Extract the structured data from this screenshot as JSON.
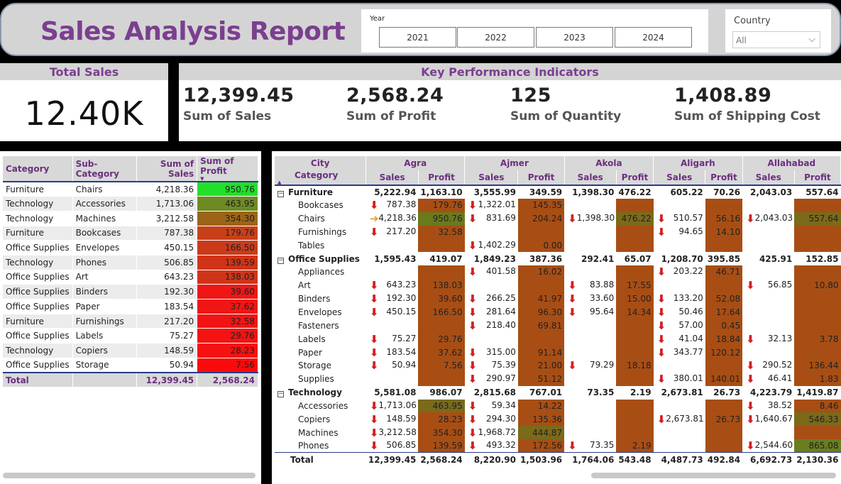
{
  "header": {
    "title": "Sales Analysis Report",
    "year_label": "Year",
    "years": [
      "2021",
      "2022",
      "2023",
      "2024"
    ],
    "country_label": "Country",
    "country_value": "All"
  },
  "total_card": {
    "title": "Total Sales",
    "value": "12.40K"
  },
  "kpi": {
    "title": "Key Performance Indicators",
    "items": [
      {
        "value": "12,399.45",
        "label": "Sum of Sales"
      },
      {
        "value": "2,568.24",
        "label": "Sum of Profit"
      },
      {
        "value": "125",
        "label": "Sum of Quantity"
      },
      {
        "value": "1,408.89",
        "label": "Sum of Shipping Cost"
      }
    ]
  },
  "left_table": {
    "headers": [
      "Category",
      "Sub-Category",
      "Sum of Sales",
      "Sum of Profit"
    ],
    "rows": [
      {
        "c": "Furniture",
        "s": "Chairs",
        "sales": "4,218.36",
        "profit": "950.76",
        "color": "#22e02a"
      },
      {
        "c": "Technology",
        "s": "Accessories",
        "sales": "1,713.06",
        "profit": "463.95",
        "color": "#6f8a22"
      },
      {
        "c": "Technology",
        "s": "Machines",
        "sales": "3,212.58",
        "profit": "354.30",
        "color": "#9c6418"
      },
      {
        "c": "Furniture",
        "s": "Bookcases",
        "sales": "787.38",
        "profit": "179.76",
        "color": "#c8401a"
      },
      {
        "c": "Office Supplies",
        "s": "Envelopes",
        "sales": "450.15",
        "profit": "166.50",
        "color": "#cc3a1a"
      },
      {
        "c": "Technology",
        "s": "Phones",
        "sales": "506.85",
        "profit": "139.59",
        "color": "#d03418"
      },
      {
        "c": "Office Supplies",
        "s": "Art",
        "sales": "643.23",
        "profit": "138.03",
        "color": "#d03418"
      },
      {
        "c": "Office Supplies",
        "s": "Binders",
        "sales": "192.30",
        "profit": "39.60",
        "color": "#f01616"
      },
      {
        "c": "Office Supplies",
        "s": "Paper",
        "sales": "183.54",
        "profit": "37.62",
        "color": "#f01616"
      },
      {
        "c": "Furniture",
        "s": "Furnishings",
        "sales": "217.20",
        "profit": "32.58",
        "color": "#f21414"
      },
      {
        "c": "Office Supplies",
        "s": "Labels",
        "sales": "75.27",
        "profit": "29.76",
        "color": "#f41212"
      },
      {
        "c": "Technology",
        "s": "Copiers",
        "sales": "148.59",
        "profit": "28.23",
        "color": "#f41212"
      },
      {
        "c": "Office Supplies",
        "s": "Storage",
        "sales": "50.94",
        "profit": "7.56",
        "color": "#fa0a0a"
      }
    ],
    "total": {
      "label": "Total",
      "sales": "12,399.45",
      "profit": "2,568.24"
    }
  },
  "matrix": {
    "row_header_top": "City",
    "row_header_bottom": "Category",
    "cities": [
      "Agra",
      "Ajmer",
      "Akola",
      "Aligarh",
      "Allahabad"
    ],
    "measure_labels": [
      "Sales",
      "Profit"
    ],
    "rows": [
      {
        "type": "grp",
        "label": "Furniture",
        "cells": [
          [
            "5,222.94",
            "1,163.10"
          ],
          [
            "3,555.99",
            "349.59"
          ],
          [
            "1,398.30",
            "476.22"
          ],
          [
            "605.22",
            "70.26"
          ],
          [
            "2,043.03",
            "557.64"
          ]
        ]
      },
      {
        "type": "sub",
        "label": "Bookcases",
        "cells": [
          [
            "787.38",
            "179.76",
            "d"
          ],
          [
            "1,322.01",
            "145.35",
            "d"
          ],
          [
            "",
            ""
          ],
          [
            "",
            ""
          ],
          [
            "",
            ""
          ]
        ]
      },
      {
        "type": "sub",
        "label": "Chairs",
        "cells": [
          [
            "4,218.36",
            "950.76",
            "r"
          ],
          [
            "831.69",
            "204.24",
            "d"
          ],
          [
            "1,398.30",
            "476.22",
            "d"
          ],
          [
            "510.57",
            "56.16",
            "d"
          ],
          [
            "2,043.03",
            "557.64",
            "d"
          ]
        ]
      },
      {
        "type": "sub",
        "label": "Furnishings",
        "cells": [
          [
            "217.20",
            "32.58",
            "d"
          ],
          [
            "",
            ""
          ],
          [
            "",
            ""
          ],
          [
            "94.65",
            "14.10",
            "d"
          ],
          [
            "",
            ""
          ]
        ]
      },
      {
        "type": "sub",
        "label": "Tables",
        "cells": [
          [
            "",
            ""
          ],
          [
            "1,402.29",
            "0.00",
            "d"
          ],
          [
            "",
            ""
          ],
          [
            "",
            ""
          ],
          [
            "",
            ""
          ]
        ]
      },
      {
        "type": "grp",
        "label": "Office Supplies",
        "cells": [
          [
            "1,595.43",
            "419.07"
          ],
          [
            "1,849.23",
            "387.36"
          ],
          [
            "292.41",
            "65.07"
          ],
          [
            "1,208.70",
            "395.85"
          ],
          [
            "425.91",
            "152.85"
          ]
        ]
      },
      {
        "type": "sub",
        "label": "Appliances",
        "cells": [
          [
            "",
            ""
          ],
          [
            "401.58",
            "16.02",
            "d"
          ],
          [
            "",
            ""
          ],
          [
            "203.22",
            "46.71",
            "d"
          ],
          [
            "",
            ""
          ]
        ]
      },
      {
        "type": "sub",
        "label": "Art",
        "cells": [
          [
            "643.23",
            "138.03",
            "d"
          ],
          [
            "",
            ""
          ],
          [
            "83.88",
            "17.55",
            "d"
          ],
          [
            "",
            ""
          ],
          [
            "56.85",
            "10.80",
            "d"
          ]
        ]
      },
      {
        "type": "sub",
        "label": "Binders",
        "cells": [
          [
            "192.30",
            "39.60",
            "d"
          ],
          [
            "266.25",
            "41.97",
            "d"
          ],
          [
            "33.60",
            "15.00",
            "d"
          ],
          [
            "133.20",
            "52.08",
            "d"
          ],
          [
            "",
            ""
          ]
        ]
      },
      {
        "type": "sub",
        "label": "Envelopes",
        "cells": [
          [
            "450.15",
            "166.50",
            "d"
          ],
          [
            "281.64",
            "96.30",
            "d"
          ],
          [
            "95.64",
            "14.34",
            "d"
          ],
          [
            "50.46",
            "17.64",
            "d"
          ],
          [
            "",
            ""
          ]
        ]
      },
      {
        "type": "sub",
        "label": "Fasteners",
        "cells": [
          [
            "",
            ""
          ],
          [
            "218.40",
            "69.81",
            "d"
          ],
          [
            "",
            ""
          ],
          [
            "57.00",
            "0.45",
            "d"
          ],
          [
            "",
            ""
          ]
        ]
      },
      {
        "type": "sub",
        "label": "Labels",
        "cells": [
          [
            "75.27",
            "29.76",
            "d"
          ],
          [
            "",
            ""
          ],
          [
            "",
            ""
          ],
          [
            "41.04",
            "18.84",
            "d"
          ],
          [
            "32.13",
            "3.78",
            "d"
          ]
        ]
      },
      {
        "type": "sub",
        "label": "Paper",
        "cells": [
          [
            "183.54",
            "37.62",
            "d"
          ],
          [
            "315.00",
            "91.14",
            "d"
          ],
          [
            "",
            ""
          ],
          [
            "343.77",
            "120.12",
            "d"
          ],
          [
            "",
            ""
          ]
        ]
      },
      {
        "type": "sub",
        "label": "Storage",
        "cells": [
          [
            "50.94",
            "7.56",
            "d"
          ],
          [
            "75.39",
            "21.00",
            "d"
          ],
          [
            "79.29",
            "18.18",
            "d"
          ],
          [
            "",
            ""
          ],
          [
            "290.52",
            "136.44",
            "d"
          ]
        ]
      },
      {
        "type": "sub",
        "label": "Supplies",
        "cells": [
          [
            "",
            ""
          ],
          [
            "290.97",
            "51.12",
            "d"
          ],
          [
            "",
            ""
          ],
          [
            "380.01",
            "140.01",
            "d"
          ],
          [
            "46.41",
            "1.83",
            "d"
          ]
        ]
      },
      {
        "type": "grp",
        "label": "Technology",
        "cells": [
          [
            "5,581.08",
            "986.07"
          ],
          [
            "2,815.68",
            "767.01"
          ],
          [
            "73.35",
            "2.19"
          ],
          [
            "2,673.81",
            "26.73"
          ],
          [
            "4,223.79",
            "1,419.87"
          ]
        ]
      },
      {
        "type": "sub",
        "label": "Accessories",
        "cells": [
          [
            "1,713.06",
            "463.95",
            "d"
          ],
          [
            "59.34",
            "14.22",
            "d"
          ],
          [
            "",
            ""
          ],
          [
            "",
            ""
          ],
          [
            "38.52",
            "8.46",
            "d"
          ]
        ]
      },
      {
        "type": "sub",
        "label": "Copiers",
        "cells": [
          [
            "148.59",
            "28.23",
            "d"
          ],
          [
            "294.30",
            "135.36",
            "d"
          ],
          [
            "",
            ""
          ],
          [
            "2,673.81",
            "26.73",
            "d"
          ],
          [
            "1,640.67",
            "546.33",
            "d"
          ]
        ]
      },
      {
        "type": "sub",
        "label": "Machines",
        "cells": [
          [
            "3,212.58",
            "354.30",
            "d"
          ],
          [
            "1,968.72",
            "444.87",
            "d"
          ],
          [
            "",
            ""
          ],
          [
            "",
            ""
          ],
          [
            "",
            ""
          ]
        ]
      },
      {
        "type": "sub",
        "label": "Phones",
        "cells": [
          [
            "506.85",
            "139.59",
            "d"
          ],
          [
            "493.32",
            "172.56",
            "d"
          ],
          [
            "73.35",
            "2.19",
            "d"
          ],
          [
            "",
            ""
          ],
          [
            "2,544.60",
            "865.08",
            "d"
          ]
        ]
      },
      {
        "type": "tot",
        "label": "Total",
        "cells": [
          [
            "12,399.45",
            "2,568.24"
          ],
          [
            "8,220.90",
            "1,503.96"
          ],
          [
            "1,764.06",
            "543.48"
          ],
          [
            "4,487.73",
            "492.84"
          ],
          [
            "6,692.73",
            "2,130.36"
          ]
        ]
      }
    ]
  },
  "colors": {
    "title": "#7b3f8f",
    "header_bg": "#d4d4d4",
    "profit_cell": "#a84e14",
    "arrow_down": "#d02020",
    "arrow_side": "#e09a30"
  }
}
